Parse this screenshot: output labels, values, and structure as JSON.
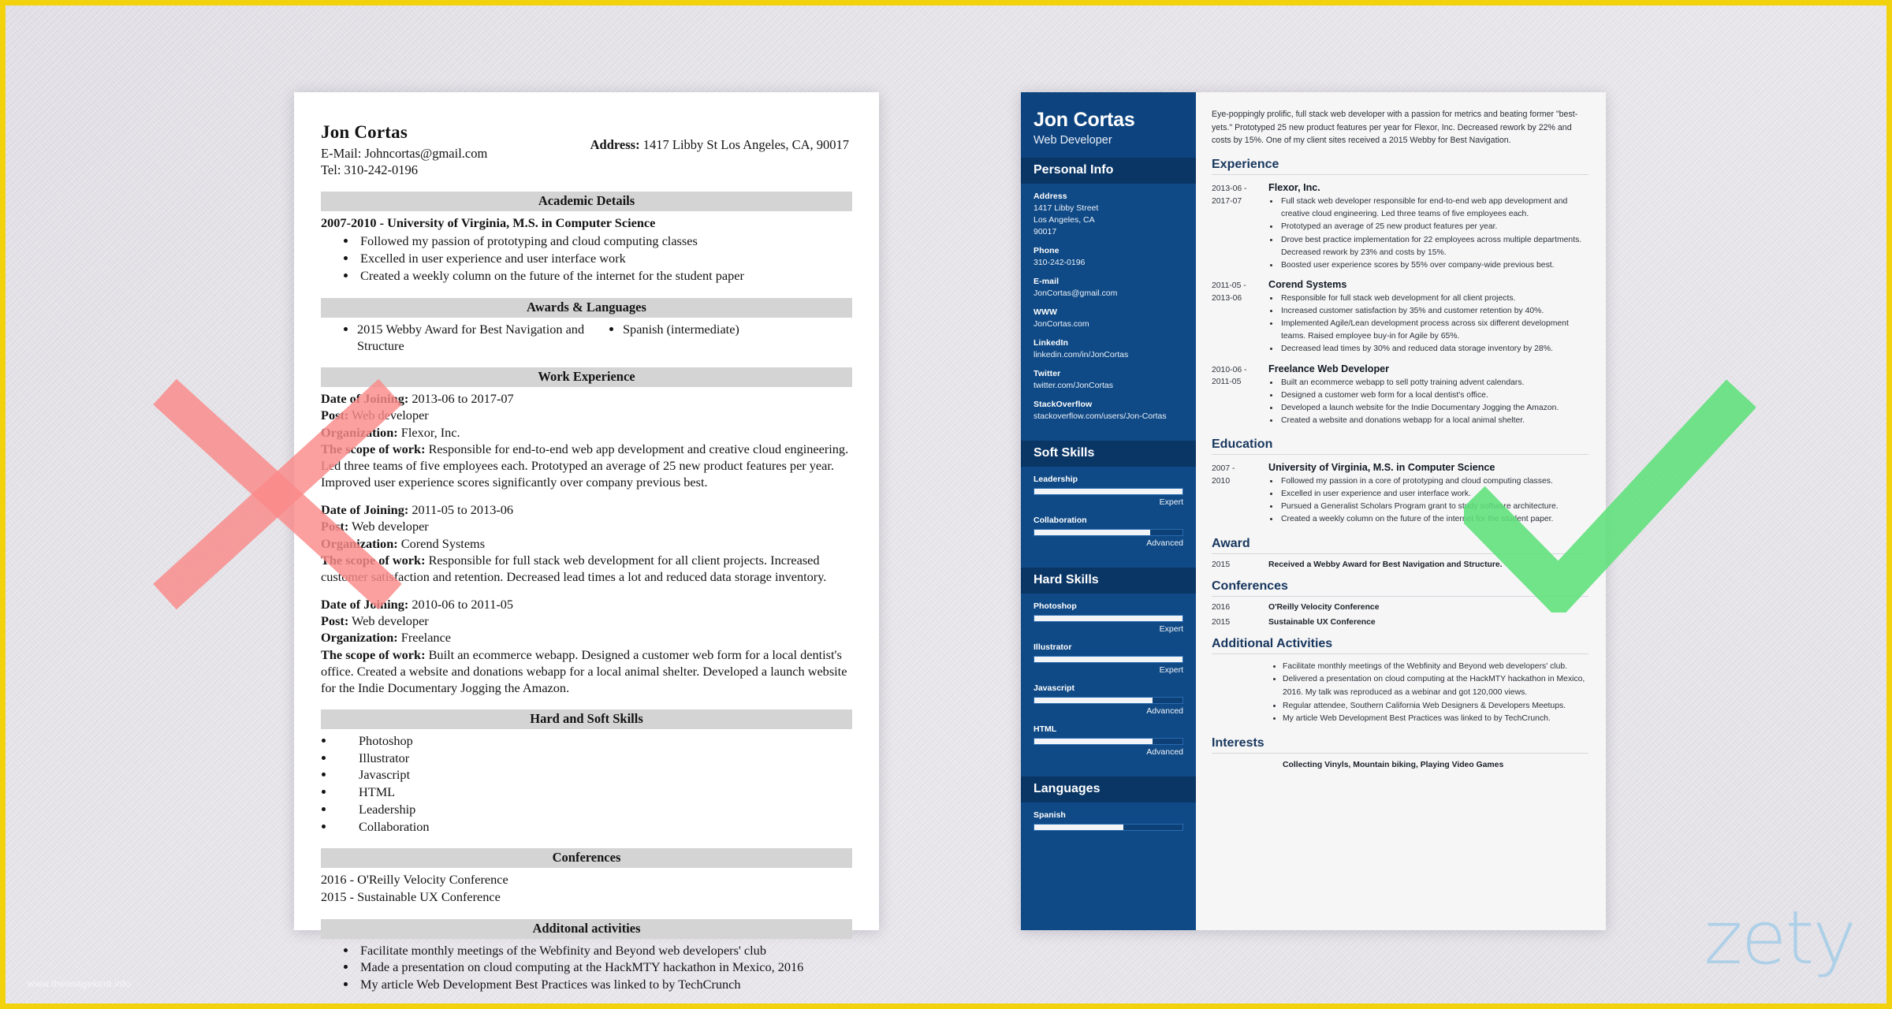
{
  "page": {
    "background_color": "#e4e2e8",
    "frame_color": "#f2d20c",
    "watermark_brand": "zety",
    "bottom_watermark": "www.theimagekind.info"
  },
  "marks": {
    "bad_mark": "red-x-mark",
    "good_mark": "green-check-mark",
    "bad_color": "#fb8a8a",
    "good_color": "#5fe07a"
  },
  "bad_resume": {
    "name": "Jon Cortas",
    "email_line": "E-Mail: Johncortas@gmail.com",
    "tel_line": "Tel: 310-242-0196",
    "address_label": "Address:",
    "address_value": "1417 Libby St Los Angeles, CA, 90017",
    "sections": {
      "academic": {
        "title": "Academic Details",
        "degree_line": "2007-2010 - University of Virginia, M.S. in Computer Science",
        "bullets": [
          "Followed my passion of prototyping and cloud computing classes",
          "Excelled in user experience and user interface work",
          "Created a weekly column on the future of the internet for the student paper"
        ]
      },
      "awards": {
        "title": "Awards & Languages",
        "left": "2015 Webby Award for Best Navigation and Structure",
        "right": "Spanish (intermediate)"
      },
      "work": {
        "title": "Work Experience",
        "jobs": [
          {
            "date_label": "Date of Joining:",
            "date_value": "2013-06 to 2017-07",
            "post_label": "Post:",
            "post_value": "Web developer",
            "org_label": "Organization:",
            "org_value": "Flexor, Inc.",
            "scope_label": "The scope of work:",
            "scope_value": "Responsible for end-to-end web app development and creative cloud engineering. Led three teams of five employees each. Prototyped an average of 25 new product features per year. Improved user experience scores significantly over company previous best."
          },
          {
            "date_label": "Date of Joining:",
            "date_value": "2011-05 to 2013-06",
            "post_label": "Post:",
            "post_value": "Web developer",
            "org_label": "Organization:",
            "org_value": "Corend Systems",
            "scope_label": "The scope of work:",
            "scope_value": "Responsible for full stack web development for all client projects. Increased customer satisfaction and retention. Decreased lead times a lot and reduced data storage inventory."
          },
          {
            "date_label": "Date of Joining:",
            "date_value": "2010-06 to 2011-05",
            "post_label": "Post:",
            "post_value": "Web developer",
            "org_label": "Organization:",
            "org_value": "Freelance",
            "scope_label": "The scope of work:",
            "scope_value": "Built an ecommerce webapp. Designed a customer web form for a local dentist's office. Created a website and donations webapp for a local animal shelter. Developed a launch website for the Indie Documentary Jogging the Amazon."
          }
        ]
      },
      "skills": {
        "title": "Hard and Soft Skills",
        "items": [
          "Photoshop",
          "Illustrator",
          "Javascript",
          "HTML",
          "Leadership",
          "Collaboration"
        ]
      },
      "conferences": {
        "title": "Conferences",
        "lines": [
          "2016 - O'Reilly Velocity Conference",
          "2015 - Sustainable UX Conference"
        ]
      },
      "additional": {
        "title": "Additonal activities",
        "bullets": [
          "Facilitate monthly meetings of the Webfinity and Beyond web developers' club",
          "Made a presentation on cloud computing at the HackMTY hackathon in Mexico, 2016",
          "My article Web Development Best Practices was linked to by TechCrunch"
        ]
      }
    }
  },
  "good_resume": {
    "sidebar": {
      "name": "Jon Cortas",
      "role": "Web Developer",
      "personal_info_title": "Personal Info",
      "fields": [
        {
          "label": "Address",
          "value": "1417 Libby Street\nLos Angeles, CA\n90017"
        },
        {
          "label": "Phone",
          "value": "310-242-0196"
        },
        {
          "label": "E-mail",
          "value": "JonCortas@gmail.com"
        },
        {
          "label": "WWW",
          "value": "JonCortas.com"
        },
        {
          "label": "LinkedIn",
          "value": "linkedin.com/in/JonCortas"
        },
        {
          "label": "Twitter",
          "value": "twitter.com/JonCortas"
        },
        {
          "label": "StackOverflow",
          "value": "stackoverflow.com/users/Jon-Cortas"
        }
      ],
      "soft_skills_title": "Soft Skills",
      "soft_skills": [
        {
          "name": "Leadership",
          "level": "Expert",
          "pct": 100
        },
        {
          "name": "Collaboration",
          "level": "Advanced",
          "pct": 78
        }
      ],
      "hard_skills_title": "Hard Skills",
      "hard_skills": [
        {
          "name": "Photoshop",
          "level": "Expert",
          "pct": 100
        },
        {
          "name": "Illustrator",
          "level": "Expert",
          "pct": 100
        },
        {
          "name": "Javascript",
          "level": "Advanced",
          "pct": 80
        },
        {
          "name": "HTML",
          "level": "Advanced",
          "pct": 80
        }
      ],
      "languages_title": "Languages",
      "languages": [
        {
          "name": "Spanish",
          "level": "",
          "pct": 60
        }
      ]
    },
    "main": {
      "summary": "Eye-poppingly prolific, full stack web developer with a passion for metrics and beating former \"best-yets.\" Prototyped 25 new product features per year for Flexor, Inc. Decreased rework by 22% and costs by 15%. One of my client sites received a 2015 Webby for Best Navigation.",
      "experience_title": "Experience",
      "experience": [
        {
          "dates": "2013-06 -\n2017-07",
          "title": "Flexor, Inc.",
          "bullets": [
            "Full stack web developer responsible for end-to-end web app development and creative cloud engineering. Led three teams of five employees each.",
            "Prototyped an average of 25 new product features per year.",
            "Drove best practice implementation for 22 employees across multiple departments. Decreased rework by 23% and costs by 15%.",
            "Boosted user experience scores by 55% over company-wide previous best."
          ]
        },
        {
          "dates": "2011-05 -\n2013-06",
          "title": "Corend Systems",
          "bullets": [
            "Responsible for full stack web development for all client projects.",
            "Increased customer satisfaction by 35% and customer retention by 40%.",
            "Implemented Agile/Lean development process across six different development teams. Raised employee buy-in for Agile by 65%.",
            "Decreased lead times by 30% and reduced data storage inventory by 28%."
          ]
        },
        {
          "dates": "2010-06 -\n2011-05",
          "title": "Freelance Web Developer",
          "bullets": [
            "Built an ecommerce webapp to sell potty training advent calendars.",
            "Designed a customer web form for a local dentist's office.",
            "Developed a launch website for the Indie Documentary Jogging the Amazon.",
            "Created a website and donations webapp for a local animal shelter."
          ]
        }
      ],
      "education_title": "Education",
      "education": [
        {
          "dates": "2007 -\n2010",
          "title": "University of Virginia, M.S. in Computer Science",
          "bullets": [
            "Followed my passion in a core of prototyping and cloud computing classes.",
            "Excelled in user experience and user interface work.",
            "Pursued a Generalist Scholars Program grant to study software architecture.",
            "Created a weekly column on the future of the internet for the student paper."
          ]
        }
      ],
      "award_title": "Award",
      "awards": [
        {
          "year": "2015",
          "text": "Received a Webby Award for Best Navigation and Structure."
        }
      ],
      "conferences_title": "Conferences",
      "conferences": [
        {
          "year": "2016",
          "text": "O'Reilly Velocity Conference"
        },
        {
          "year": "2015",
          "text": "Sustainable UX Conference"
        }
      ],
      "additional_title": "Additional Activities",
      "additional": [
        "Facilitate monthly meetings of the Webfinity and Beyond web developers' club.",
        "Delivered a presentation on cloud computing at the HackMTY hackathon in Mexico, 2016. My talk was reproduced as a webinar and got 120,000 views.",
        "Regular attendee, Southern California Web Designers & Developers Meetups.",
        "My article Web Development Best Practices was linked to by TechCrunch."
      ],
      "interests_title": "Interests",
      "interests_text": "Collecting Vinyls, Mountain biking, Playing Video Games"
    }
  }
}
